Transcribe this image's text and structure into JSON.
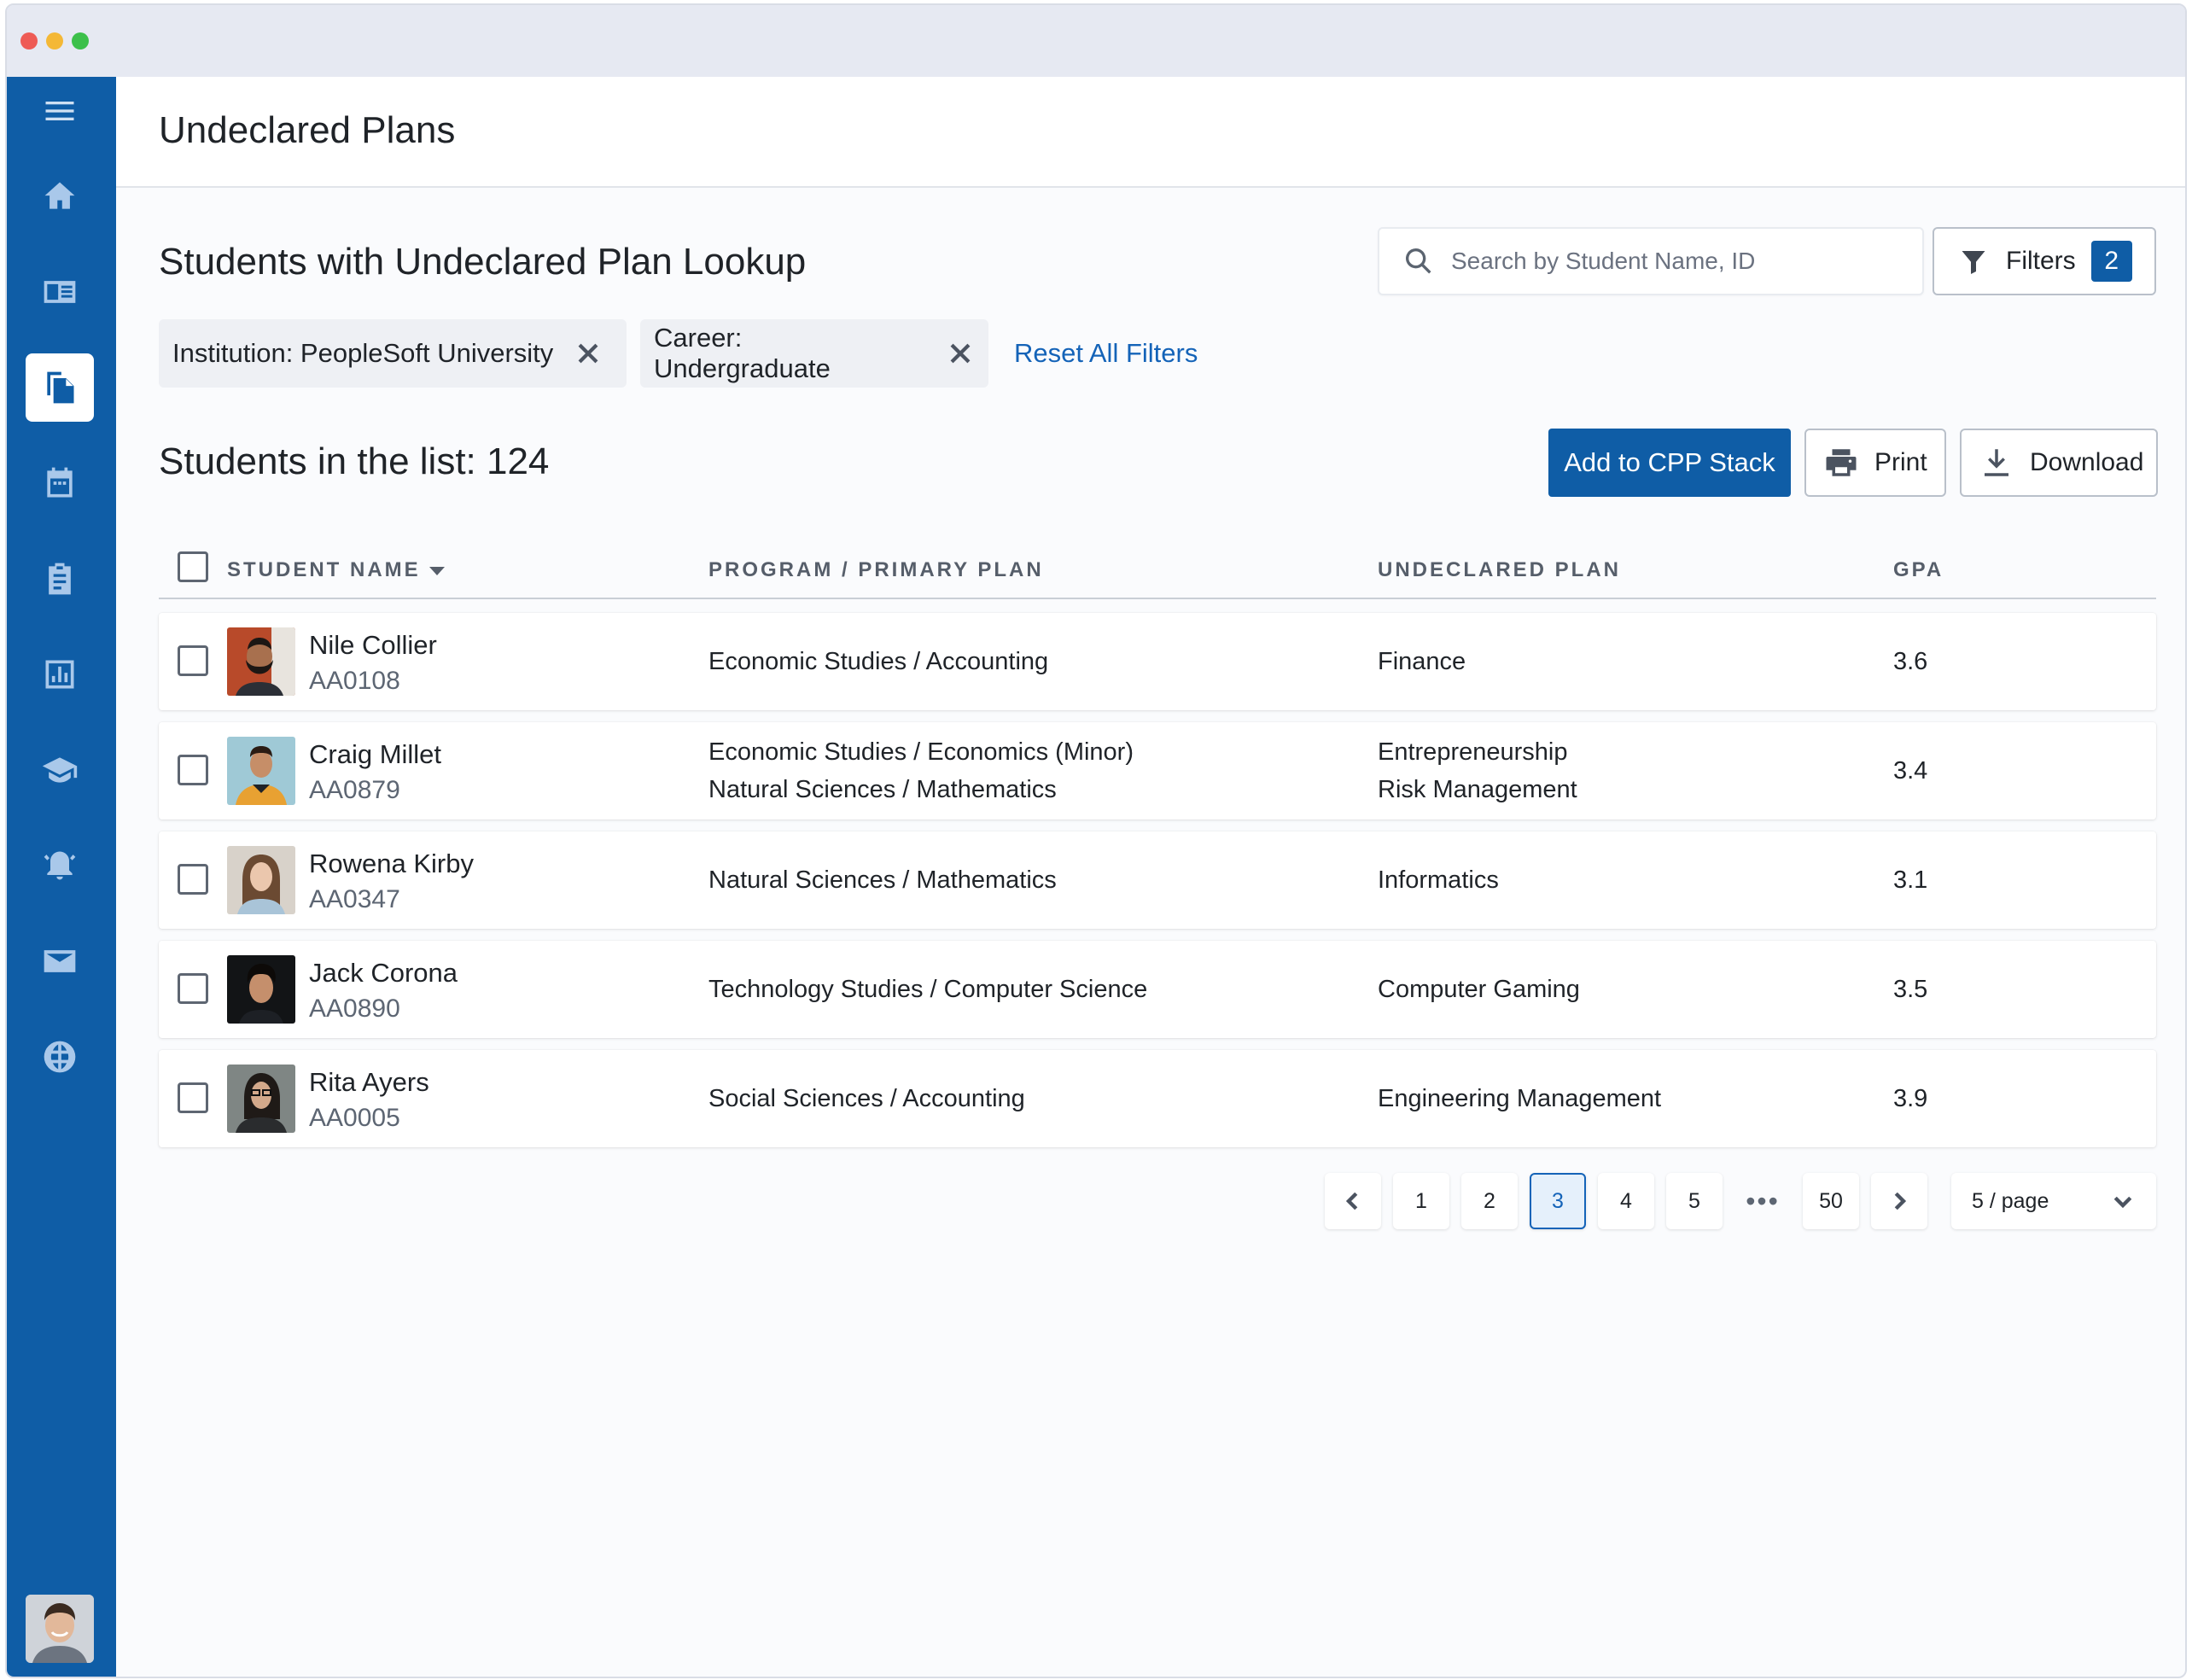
{
  "window": {
    "traffic_lights": [
      "#ee5b55",
      "#f4b836",
      "#3cc04a"
    ]
  },
  "colors": {
    "brand": "#0f5da6",
    "link": "#1463b8"
  },
  "sidebar": {
    "items": [
      {
        "name": "menu",
        "icon": "hamburger-icon"
      },
      {
        "name": "home",
        "icon": "home-icon"
      },
      {
        "name": "catalog",
        "icon": "book-icon"
      },
      {
        "name": "documents",
        "icon": "documents-icon",
        "active": true
      },
      {
        "name": "calendar",
        "icon": "calendar-icon"
      },
      {
        "name": "assignments",
        "icon": "clipboard-icon"
      },
      {
        "name": "reports",
        "icon": "bar-chart-icon"
      },
      {
        "name": "academics",
        "icon": "graduation-cap-icon"
      },
      {
        "name": "alerts",
        "icon": "alarm-bell-icon"
      },
      {
        "name": "messages",
        "icon": "mail-icon"
      },
      {
        "name": "web",
        "icon": "globe-icon"
      }
    ],
    "user_avatar": "user-avatar"
  },
  "header": {
    "title": "Undeclared Plans"
  },
  "lookup": {
    "title": "Students with Undeclared Plan Lookup",
    "search_placeholder": "Search by Student Name, ID",
    "filters_label": "Filters",
    "filters_count": "2"
  },
  "chips": [
    {
      "label": "Institution: PeopleSoft University"
    },
    {
      "label": "Career: Undergraduate"
    }
  ],
  "reset_label": "Reset All Filters",
  "list": {
    "count_title": "Students in the list: 124",
    "add_button": "Add to CPP Stack",
    "print_button": "Print",
    "download_button": "Download"
  },
  "table": {
    "columns": [
      "STUDENT NAME",
      "PROGRAM / PRIMARY PLAN",
      "UNDECLARED PLAN",
      "GPA"
    ],
    "rows": [
      {
        "name": "Nile Collier",
        "id": "AA0108",
        "program": [
          "Economic Studies / Accounting"
        ],
        "undeclared": [
          "Finance"
        ],
        "gpa": "3.6"
      },
      {
        "name": "Craig Millet",
        "id": "AA0879",
        "program": [
          "Economic Studies / Economics (Minor)",
          "Natural Sciences / Mathematics"
        ],
        "undeclared": [
          "Entrepreneurship",
          "Risk Management"
        ],
        "gpa": "3.4"
      },
      {
        "name": "Rowena Kirby",
        "id": "AA0347",
        "program": [
          "Natural Sciences / Mathematics"
        ],
        "undeclared": [
          "Informatics"
        ],
        "gpa": "3.1"
      },
      {
        "name": "Jack Corona",
        "id": "AA0890",
        "program": [
          "Technology Studies / Computer Science"
        ],
        "undeclared": [
          "Computer Gaming"
        ],
        "gpa": "3.5"
      },
      {
        "name": "Rita Ayers",
        "id": "AA0005",
        "program": [
          "Social Sciences / Accounting"
        ],
        "undeclared": [
          "Engineering Management"
        ],
        "gpa": "3.9"
      }
    ]
  },
  "pagination": {
    "pages": [
      "1",
      "2",
      "3",
      "4",
      "5"
    ],
    "current": "3",
    "ellipsis": "•••",
    "last": "50",
    "per_page": "5 / page"
  }
}
